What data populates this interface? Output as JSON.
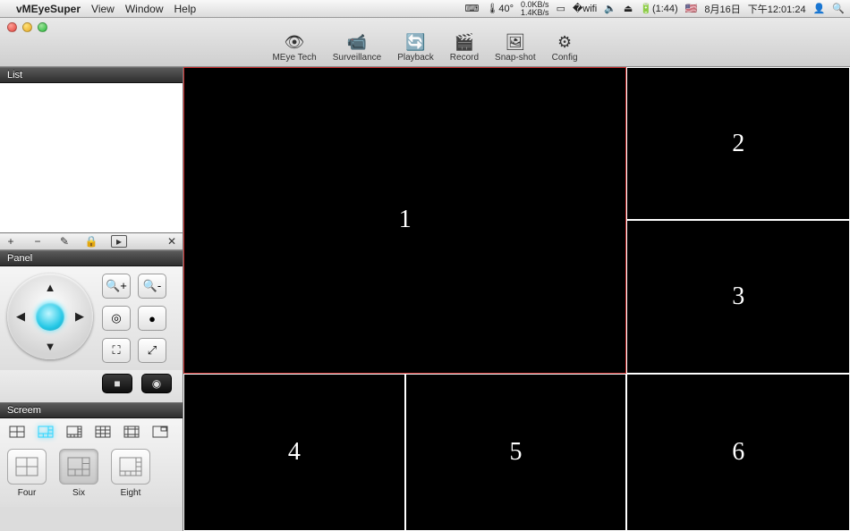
{
  "menubar": {
    "app": "vMEyeSuper",
    "items": [
      "View",
      "Window",
      "Help"
    ],
    "status": {
      "temp": "40°",
      "net_up": "0.0KB/s",
      "net_down": "1.4KB/s",
      "battery": "(1:44)",
      "date": "8月16日",
      "time": "下午12:01:24"
    }
  },
  "toolbar": [
    {
      "id": "meye-tech",
      "label": "MEye Tech",
      "glyph": "👁"
    },
    {
      "id": "surveillance",
      "label": "Surveillance",
      "glyph": "📹"
    },
    {
      "id": "playback",
      "label": "Playback",
      "glyph": "🔄"
    },
    {
      "id": "record",
      "label": "Record",
      "glyph": "🎬"
    },
    {
      "id": "snapshot",
      "label": "Snap-shot",
      "glyph": "🖼"
    },
    {
      "id": "config",
      "label": "Config",
      "glyph": "⚙"
    }
  ],
  "sidebar": {
    "list": {
      "title": "List"
    },
    "list_tools": {
      "add": "+",
      "remove": "−",
      "edit": "✎",
      "lock": "🔒",
      "play": "▸",
      "close": "✕"
    },
    "panel": {
      "title": "Panel"
    },
    "screen": {
      "title": "Screem",
      "big_buttons": [
        {
          "id": "four",
          "label": "Four"
        },
        {
          "id": "six",
          "label": "Six",
          "active": true
        },
        {
          "id": "eight",
          "label": "Eight"
        }
      ]
    }
  },
  "cells": [
    "1",
    "2",
    "3",
    "4",
    "5",
    "6"
  ]
}
